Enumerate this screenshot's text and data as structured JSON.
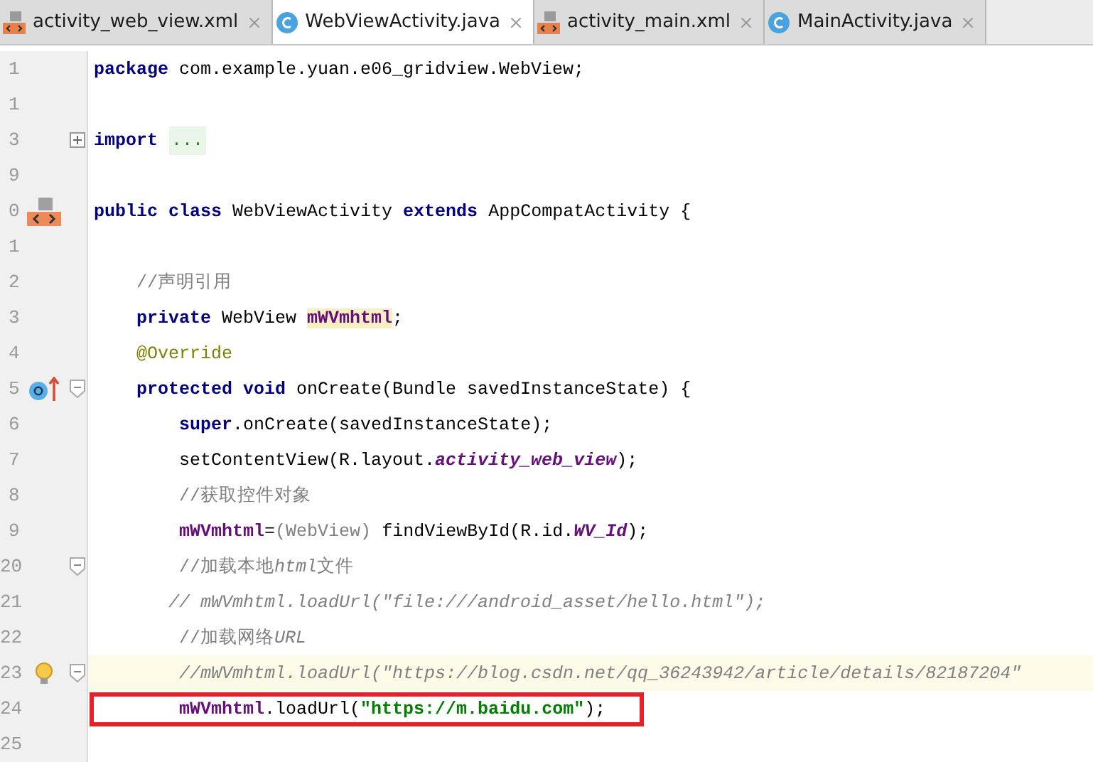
{
  "tabs": [
    {
      "label": "activity_web_view.xml",
      "kind": "xml",
      "selected": false
    },
    {
      "label": "WebViewActivity.java",
      "kind": "class",
      "selected": true
    },
    {
      "label": "activity_main.xml",
      "kind": "xml",
      "selected": false
    },
    {
      "label": "MainActivity.java",
      "kind": "class",
      "selected": false
    }
  ],
  "lines": [
    {
      "number": "1",
      "tokens": [
        {
          "kind": "keyword",
          "text": "package"
        },
        {
          "kind": "plain",
          "text": " com.example.yuan.e06_gridview.WebView;"
        }
      ]
    },
    {
      "number": "1"
    },
    {
      "number": "3",
      "gutter": [
        {
          "kind": "fold-plus"
        }
      ],
      "tokens": [
        {
          "kind": "keyword",
          "text": "import "
        },
        {
          "kind": "folded",
          "text": "..."
        }
      ]
    },
    {
      "number": "9"
    },
    {
      "number": "0",
      "gutter": [
        {
          "kind": "xml"
        }
      ],
      "tokens": [
        {
          "kind": "keyword",
          "text": "public class"
        },
        {
          "kind": "plain",
          "text": " WebViewActivity "
        },
        {
          "kind": "keyword",
          "text": "extends"
        },
        {
          "kind": "plain",
          "text": " AppCompatActivity {"
        }
      ]
    },
    {
      "number": "1"
    },
    {
      "number": "2",
      "tokens": [
        {
          "kind": "comment",
          "text": "    //声明引用"
        }
      ]
    },
    {
      "number": "3",
      "tokens": [
        {
          "kind": "keyword",
          "text": "    private"
        },
        {
          "kind": "plain",
          "text": " WebView "
        },
        {
          "kind": "field-marked",
          "text": "mWVmhtml"
        },
        {
          "kind": "plain",
          "text": ";"
        }
      ]
    },
    {
      "number": "4",
      "tokens": [
        {
          "kind": "annotation",
          "text": "    @Override"
        }
      ]
    },
    {
      "number": "5",
      "gutter": [
        {
          "kind": "override"
        },
        {
          "kind": "fold-minus"
        }
      ],
      "tokens": [
        {
          "kind": "keyword",
          "text": "    protected void"
        },
        {
          "kind": "plain",
          "text": " onCreate(Bundle savedInstanceState) {"
        }
      ]
    },
    {
      "number": "6",
      "tokens": [
        {
          "kind": "keyword",
          "text": "        super"
        },
        {
          "kind": "plain",
          "text": ".onCreate(savedInstanceState);"
        }
      ]
    },
    {
      "number": "7",
      "tokens": [
        {
          "kind": "plain",
          "text": "        setContentView(R.layout."
        },
        {
          "kind": "static",
          "text": "activity_web_view"
        },
        {
          "kind": "plain",
          "text": ");"
        }
      ]
    },
    {
      "number": "8",
      "tokens": [
        {
          "kind": "comment",
          "text": "        //获取控件对象"
        }
      ]
    },
    {
      "number": "9",
      "tokens": [
        {
          "kind": "field",
          "text": "        mWVmhtml"
        },
        {
          "kind": "plain",
          "text": "="
        },
        {
          "kind": "cast",
          "text": "(WebView)"
        },
        {
          "kind": "plain",
          "text": " findViewById(R.id."
        },
        {
          "kind": "static",
          "text": "WV_Id"
        },
        {
          "kind": "plain",
          "text": ");"
        }
      ]
    },
    {
      "number": "20",
      "gutter": [
        {
          "kind": "fold-minus"
        }
      ],
      "tokens": [
        {
          "kind": "comment",
          "text": "        //加载本地"
        },
        {
          "kind": "comment-italic",
          "text": "html"
        },
        {
          "kind": "comment",
          "text": "文件"
        }
      ]
    },
    {
      "number": "21",
      "tokens": [
        {
          "kind": "comment-italic",
          "text": "       // mWVmhtml.loadUrl(\"file:///android_asset/hello.html\");"
        }
      ]
    },
    {
      "number": "22",
      "tokens": [
        {
          "kind": "comment",
          "text": "        //加载网络"
        },
        {
          "kind": "comment-italic",
          "text": "URL"
        }
      ]
    },
    {
      "number": "23",
      "gutter": [
        {
          "kind": "bulb"
        },
        {
          "kind": "fold-minus"
        }
      ],
      "highlighted": true,
      "tokens": [
        {
          "kind": "comment-italic",
          "text": "        //mWVmhtml.loadUrl(\"https://blog.csdn.net/qq_36243942/article/details/82187204\""
        }
      ]
    },
    {
      "number": "24",
      "boxed": true,
      "tokens": [
        {
          "kind": "field",
          "text": "        mWVmhtml"
        },
        {
          "kind": "plain",
          "text": ".loadUrl("
        },
        {
          "kind": "string",
          "text": "\"https://m.baidu.com\""
        },
        {
          "kind": "plain",
          "text": ");"
        }
      ]
    },
    {
      "number": "25"
    }
  ]
}
